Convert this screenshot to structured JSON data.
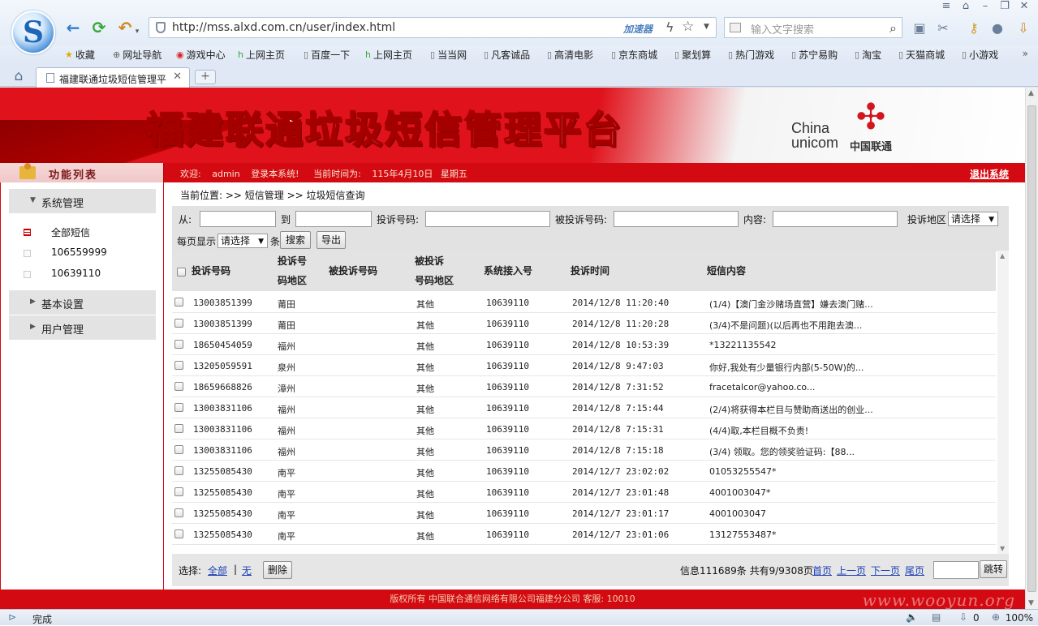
{
  "browser": {
    "url": "http://mss.alxd.com.cn/user/index.html",
    "accelerator_label": "加速器",
    "search_placeholder": "输入文字搜索",
    "tab_title": "福建联通垃圾短信管理平",
    "bookmarks": [
      "收藏",
      "网址导航",
      "游戏中心",
      "上网主页",
      "百度一下",
      "上网主页",
      "当当网",
      "凡客诚品",
      "高清电影",
      "京东商城",
      "聚划算",
      "热门游戏",
      "苏宁易购",
      "淘宝",
      "天猫商城",
      "小游戏"
    ],
    "status_text": "完成",
    "download_count": "0",
    "zoom": "100%"
  },
  "banner": {
    "title": "福建联通垃圾短信管理平台",
    "logo_en_1": "China",
    "logo_en_2": "unicom",
    "logo_cn": "中国联通"
  },
  "header": {
    "menu_title": "功能列表",
    "welcome_prefix": "欢迎:",
    "user": "admin",
    "welcome_suffix": "登录本系统!",
    "time_label": "当前时间为:",
    "date": "115年4月10日",
    "weekday": "星期五",
    "logout": "退出系统"
  },
  "sidebar": {
    "sections": [
      {
        "label": "系统管理",
        "expanded": true
      },
      {
        "label": "基本设置",
        "expanded": false
      },
      {
        "label": "用户管理",
        "expanded": false
      }
    ],
    "sub_items": [
      "全部短信",
      "106559999",
      "10639110"
    ]
  },
  "breadcrumb": "当前位置: >> 短信管理 >> 垃圾短信查询",
  "filter": {
    "from_label": "从:",
    "to_label": "到",
    "complaint_number_label": "投诉号码:",
    "complained_number_label": "被投诉号码:",
    "content_label": "内容:",
    "region_label": "投诉地区",
    "region_select": "请选择",
    "per_page_label": "每页显示",
    "per_page_select": "请选择",
    "per_page_unit": "条",
    "search_button": "搜索",
    "export_button": "导出"
  },
  "table": {
    "headers": [
      "投诉号码",
      "投诉号码地区",
      "被投诉号码",
      "被投诉号码地区",
      "系统接入号",
      "投诉时间",
      "短信内容"
    ],
    "header_lines": {
      "region_1": "投诉号",
      "region_2": "码地区",
      "bregion_1": "被投诉",
      "bregion_2": "号码地区"
    },
    "rows": [
      [
        "13003851399",
        "莆田",
        "",
        "其他",
        "10639110",
        "2014/12/8 11:20:40",
        "(1/4)【澳门金沙赌场直营】嫌去澳门赌..."
      ],
      [
        "13003851399",
        "莆田",
        "",
        "其他",
        "10639110",
        "2014/12/8 11:20:28",
        "(3/4)不是问题)(以后再也不用跑去澳..."
      ],
      [
        "18650454059",
        "福州",
        "",
        "其他",
        "10639110",
        "2014/12/8 10:53:39",
        "*13221135542"
      ],
      [
        "13205059591",
        "泉州",
        "",
        "其他",
        "10639110",
        "2014/12/8 9:47:03",
        "你好,我处有少量银行内部(5-50W)的..."
      ],
      [
        "18659668826",
        "漳州",
        "",
        "其他",
        "10639110",
        "2014/12/8 7:31:52",
        "fracetalcor@yahoo.co..."
      ],
      [
        "13003831106",
        "福州",
        "",
        "其他",
        "10639110",
        "2014/12/8 7:15:44",
        "(2/4)将获得本栏目与赞助商送出的创业..."
      ],
      [
        "13003831106",
        "福州",
        "",
        "其他",
        "10639110",
        "2014/12/8 7:15:31",
        "(4/4)取,本栏目概不负责!"
      ],
      [
        "13003831106",
        "福州",
        "",
        "其他",
        "10639110",
        "2014/12/8 7:15:18",
        "(3/4) 领取。您的领奖验证码:【88..."
      ],
      [
        "13255085430",
        "南平",
        "",
        "其他",
        "10639110",
        "2014/12/7 23:02:02",
        "01053255547*"
      ],
      [
        "13255085430",
        "南平",
        "",
        "其他",
        "10639110",
        "2014/12/7 23:01:48",
        "4001003047*"
      ],
      [
        "13255085430",
        "南平",
        "",
        "其他",
        "10639110",
        "2014/12/7 23:01:17",
        "4001003047"
      ],
      [
        "13255085430",
        "南平",
        "",
        "其他",
        "10639110",
        "2014/12/7 23:01:06",
        "13127553487*"
      ]
    ]
  },
  "pager": {
    "select_label": "选择:",
    "all": "全部",
    "sep": "|",
    "none": "无",
    "delete_button": "删除",
    "info": "信息111689条 共有9/9308页",
    "first": "首页",
    "prev": "上一页",
    "next": "下一页",
    "last": "尾页",
    "jump_button": "跳转"
  },
  "footer": {
    "text": "版权所有  中国联合通信网络有限公司福建分公司  客服: 10010",
    "watermark": "www.wooyun.org"
  },
  "colors": {
    "brand_red": "#d40a12",
    "link_blue": "#1b3fb5"
  }
}
